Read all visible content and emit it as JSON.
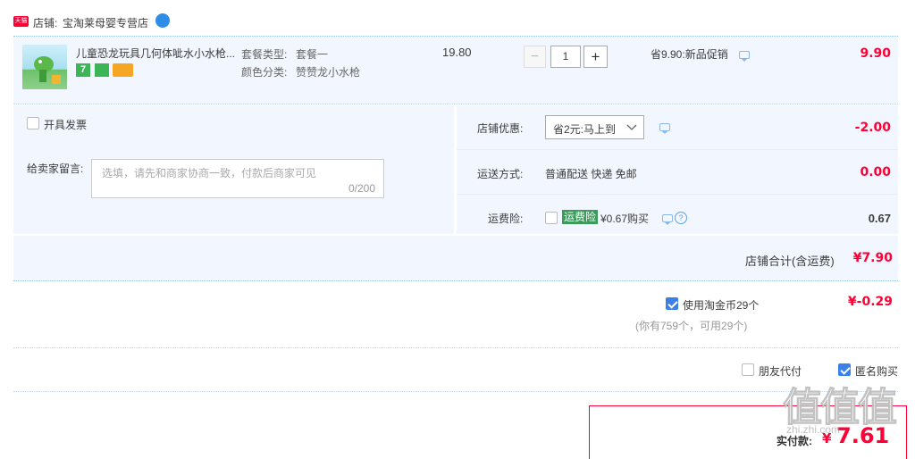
{
  "shop": {
    "badge": "天猫",
    "label": "店铺:",
    "name": "宝淘莱母婴专营店"
  },
  "item": {
    "title": "儿童恐龙玩具几何体呲水小水枪...",
    "package_label": "套餐类型:",
    "package_value": "套餐一",
    "color_label": "颜色分类:",
    "color_value": "赞赞龙小水枪",
    "badge_seven": "7",
    "unit_price": "19.80",
    "minus": "−",
    "plus": "+",
    "quantity": "1",
    "promo": "省9.90:新品促销",
    "subtotal": "9.90"
  },
  "invoice": {
    "label": "开具发票"
  },
  "seller_message": {
    "label": "给卖家留言:",
    "placeholder": "选填，请先和商家协商一致，付款后商家可见",
    "counter": "0/200"
  },
  "shop_discount": {
    "label": "店铺优惠:",
    "selected": "省2元:马上到",
    "amount": "-2.00"
  },
  "shipping": {
    "label": "运送方式:",
    "value": "普通配送 快递 免邮",
    "amount": "0.00"
  },
  "freight_insurance": {
    "label": "运费险:",
    "tag": "运费险",
    "price": "¥0.67购买",
    "help": "?",
    "amount": "0.67"
  },
  "shop_total": {
    "label": "店铺合计(含运费)",
    "amount": "¥7.90"
  },
  "taojinbi": {
    "label": "使用淘金币29个",
    "note": "(你有759个，可用29个)",
    "amount": "¥-0.29"
  },
  "options": {
    "friend_pay": "朋友代付",
    "anonymous": "匿名购买"
  },
  "payment": {
    "label": "实付款:",
    "currency": "¥",
    "amount": "7.61"
  },
  "watermark": {
    "text": "值值值",
    "sub": "zhi.zhi.com"
  },
  "colors": {
    "accent_red": "#ff0036",
    "panel_blue": "#f2f7ff",
    "checkbox_blue": "#3a80e6",
    "insurance_green": "#3a9b5a"
  }
}
